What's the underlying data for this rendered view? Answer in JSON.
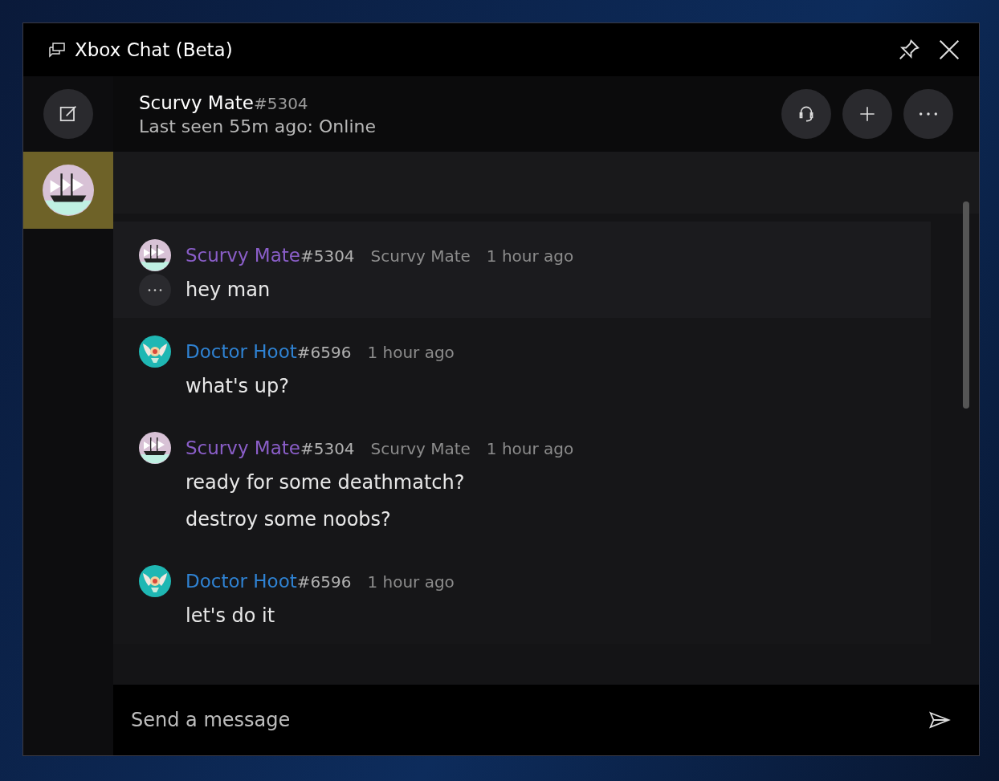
{
  "window": {
    "title": "Xbox Chat (Beta)"
  },
  "sidebar": {
    "conversations": [
      {
        "kind": "ship",
        "selected": true
      }
    ]
  },
  "header": {
    "name": "Scurvy Mate",
    "tag": "#5304",
    "status": "Last seen 55m ago: Online"
  },
  "messages": [
    {
      "kind": "ship",
      "author": "Scurvy Mate",
      "tag": "#5304",
      "display_name": "Scurvy Mate",
      "time": "1 hour ago",
      "color": "#8a5ec8",
      "hovered": true,
      "lines": [
        "hey man"
      ]
    },
    {
      "kind": "owl",
      "author": "Doctor Hoot",
      "tag": "#6596",
      "time": "1 hour ago",
      "color": "#2f82d2",
      "hovered": false,
      "lines": [
        "what's up?"
      ]
    },
    {
      "kind": "ship",
      "author": "Scurvy Mate",
      "tag": "#5304",
      "display_name": "Scurvy Mate",
      "time": "1 hour ago",
      "color": "#8a5ec8",
      "hovered": false,
      "lines": [
        "ready for some deathmatch?",
        "destroy some noobs?"
      ]
    },
    {
      "kind": "owl",
      "author": "Doctor Hoot",
      "tag": "#6596",
      "time": "1 hour ago",
      "color": "#2f82d2",
      "hovered": false,
      "lines": [
        "let's do it"
      ]
    }
  ],
  "composer": {
    "placeholder": "Send a message"
  }
}
